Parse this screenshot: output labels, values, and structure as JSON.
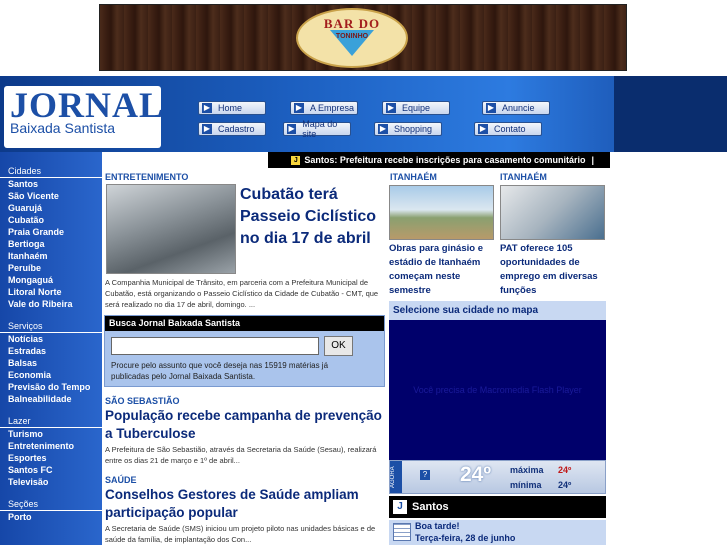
{
  "banner": {
    "logo_line1": "BAR DO",
    "logo_line2": "TONINHO"
  },
  "header": {
    "logo_title": "JORNAL",
    "logo_subtitle": "Baixada Santista"
  },
  "nav": [
    {
      "label": "Home"
    },
    {
      "label": "A Empresa"
    },
    {
      "label": "Equipe"
    },
    {
      "label": "Anuncie"
    },
    {
      "label": "Cadastro"
    },
    {
      "label": "Mapa do site"
    },
    {
      "label": "Shopping"
    },
    {
      "label": "Contato"
    }
  ],
  "sidebar": {
    "cidades_label": "Cidades",
    "cidades": [
      "Santos",
      "São Vicente",
      "Guarujá",
      "Cubatão",
      "Praia Grande",
      "Bertioga",
      "Itanhaém",
      "Peruíbe",
      "Mongaguá",
      "Litoral Norte",
      "Vale do Ribeira"
    ],
    "servicos_label": "Serviços",
    "servicos": [
      "Notícias",
      "Estradas",
      "Balsas",
      "Economia",
      "Previsão do Tempo",
      "Balneabilidade"
    ],
    "lazer_label": "Lazer",
    "lazer": [
      "Turismo",
      "Entretenimento",
      "Esportes",
      "Santos FC",
      "Televisão"
    ],
    "secoes_label": "Seções",
    "secoes": [
      "Porto"
    ]
  },
  "ticker": {
    "text": "Santos: Prefeitura recebe inscrições para casamento comunitário"
  },
  "news_main": {
    "section": "ENTRETENIMENTO",
    "title": "Cubatão terá Passeio Ciclístico no dia 17 de abril",
    "body": "A Companhia Municipal de Trânsito, em parceria com a Prefeitura Municipal de Cubatão, está organizando o Passeio Ciclístico da Cidade de Cubatão - CMT, que será realizado no dia 17 de abril, domingo. ..."
  },
  "search": {
    "heading": "Busca Jornal Baixada Santista",
    "input_value": "",
    "button": "OK",
    "description": "Procure pelo assunto que você deseja nas 15919 matérias já publicadas pelo Jornal Baixada Santista."
  },
  "news2": {
    "section": "SÃO SEBASTIÃO",
    "title": "População recebe campanha de prevenção a Tuberculose",
    "body": "A Prefeitura de São Sebastião, através da Secretaria da Saúde (Sesau), realizará entre os dias 21 de março e 1º de abril..."
  },
  "news3": {
    "section": "SAÚDE",
    "title": "Conselhos Gestores de Saúde ampliam participação popular",
    "body": "A Secretaria de Saúde (SMS) iniciou um projeto piloto nas unidades básicas e de saúde da família, de implantação dos Con..."
  },
  "side_news": [
    {
      "section": "ITANHAÉM",
      "title": "Obras para ginásio e estádio de Itanhaém começam neste semestre"
    },
    {
      "section": "ITANHAÉM",
      "title": "PAT oferece 105 oportunidades de emprego em diversas funções"
    }
  ],
  "map": {
    "heading": "Selecione sua cidade no mapa",
    "text": "Você precisa de Macromedia Flash Player"
  },
  "weather": {
    "side_label": "AGORA",
    "temp": "24º",
    "max_label": "máxima",
    "max": "24º",
    "min_label": "mínima",
    "min": "24º"
  },
  "santos": {
    "label": "Santos",
    "greeting": "Boa tarde!",
    "date": "Terça-feira, 28 de junho"
  }
}
